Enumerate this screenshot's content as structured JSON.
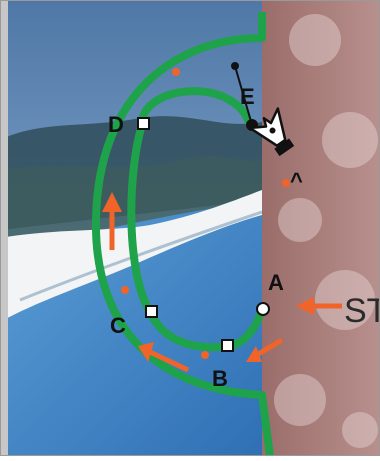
{
  "canvas": {
    "anchor_labels": {
      "a": "A",
      "b": "B",
      "c": "C",
      "d": "D",
      "e": "E"
    },
    "side_label": "ST",
    "path_color": "#1ea34a",
    "arrow_color": "#f0642a",
    "anchor_color": "#ffffff"
  },
  "tool": {
    "name": "pen-tool-icon",
    "cursor_modifier": "^"
  }
}
